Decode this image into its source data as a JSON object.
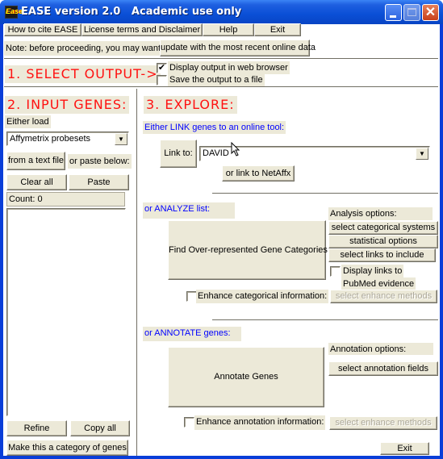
{
  "window": {
    "title": "EASE version 2.0   Academic use only",
    "app_icon_text": "Ease",
    "controls": {
      "minimize": "minimize",
      "maximize": "maximize",
      "close": "✕"
    }
  },
  "menu": {
    "buttons": [
      "How to cite EASE",
      "License terms and Disclaimer",
      "Help",
      "Exit"
    ]
  },
  "note": {
    "text": "Note: before proceeding, you may want to",
    "update_button": "update with the most recent online data"
  },
  "output": {
    "heading": "1. SELECT OUTPUT->",
    "options": [
      {
        "label": "Display output in web browser",
        "checked": true
      },
      {
        "label": "Save the output to a file",
        "checked": false
      }
    ]
  },
  "input": {
    "heading": "2. INPUT GENES:",
    "either_load": "Either load",
    "type_select": "Affymetrix probesets",
    "from_file_button": "from a text file",
    "or_paste": "or paste below:",
    "clear_button": "Clear all",
    "paste_button": "Paste",
    "count": "Count: 0",
    "refine_button": "Refine",
    "copy_button": "Copy all",
    "make_category_button": "Make this a category of genes"
  },
  "explore": {
    "heading": "3. EXPLORE:",
    "link": {
      "label": "Either LINK genes to an online tool:",
      "link_to_button": "Link to:",
      "tool_select": "DAVID",
      "netaffx_button": "or link to NetAffx"
    },
    "analyze": {
      "label": "or ANALYZE list:",
      "find_button": "Find Over-represented Gene Categories",
      "options_label": "Analysis options:",
      "option_buttons": [
        "select categorical systems",
        "statistical options",
        "select links to include"
      ],
      "pubmed_checkbox": {
        "label_line1": "Display links to",
        "label_line2": "PubMed evidence",
        "checked": false
      },
      "enhance_checkbox": {
        "label": "Enhance categorical information:",
        "checked": false
      },
      "enhance_button": "select enhance methods"
    },
    "annotate": {
      "label": "or ANNOTATE genes:",
      "annotate_button": "Annotate Genes",
      "options_label": "Annotation options:",
      "fields_button": "select annotation fields",
      "enhance_checkbox": {
        "label": "Enhance annotation information:",
        "checked": false
      },
      "enhance_button": "select enhance methods"
    },
    "exit_button": "Exit"
  }
}
